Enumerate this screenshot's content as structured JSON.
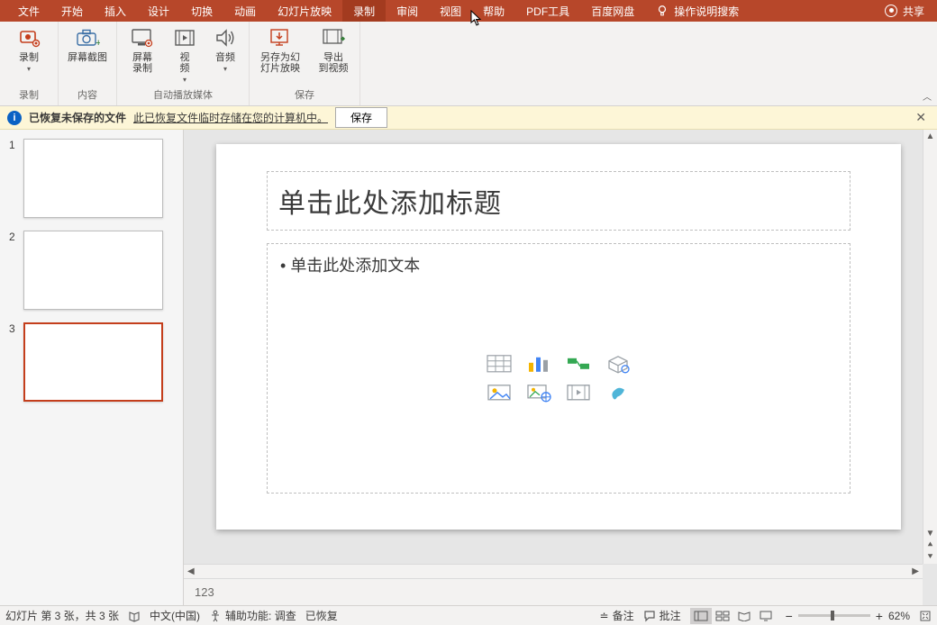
{
  "tabs": {
    "file": "文件",
    "home": "开始",
    "insert": "插入",
    "design": "设计",
    "transition": "切换",
    "animation": "动画",
    "slideshow": "幻灯片放映",
    "record": "录制",
    "review": "审阅",
    "view": "视图",
    "help": "帮助",
    "pdf": "PDF工具",
    "baidu": "百度网盘",
    "tellme": "操作说明搜索"
  },
  "share_label": "共享",
  "ribbon": {
    "record_group": {
      "record": "录制",
      "label": "录制"
    },
    "content_group": {
      "screenshot": "屏幕截图",
      "label": "内容"
    },
    "media_group": {
      "screen_record": "屏幕\n录制",
      "video": "视\n频",
      "audio": "音频",
      "label": "自动播放媒体"
    },
    "save_group": {
      "save_as_show": "另存为幻\n灯片放映",
      "export_video": "导出\n到视频",
      "label": "保存"
    }
  },
  "infobar": {
    "title": "已恢复未保存的文件",
    "desc": "此已恢复文件临时存储在您的计算机中。",
    "save_btn": "保存"
  },
  "thumbs": {
    "n1": "1",
    "n2": "2",
    "n3": "3"
  },
  "slide": {
    "title_placeholder": "单击此处添加标题",
    "content_placeholder": "单击此处添加文本"
  },
  "notes_placeholder": "123",
  "status": {
    "slide_info": "幻灯片 第 3 张，共 3 张",
    "lang": "中文(中国)",
    "accessibility": "辅助功能: 调查",
    "restored": "已恢复",
    "notes_btn": "备注",
    "comments_btn": "批注",
    "zoom_pct": "62%"
  }
}
